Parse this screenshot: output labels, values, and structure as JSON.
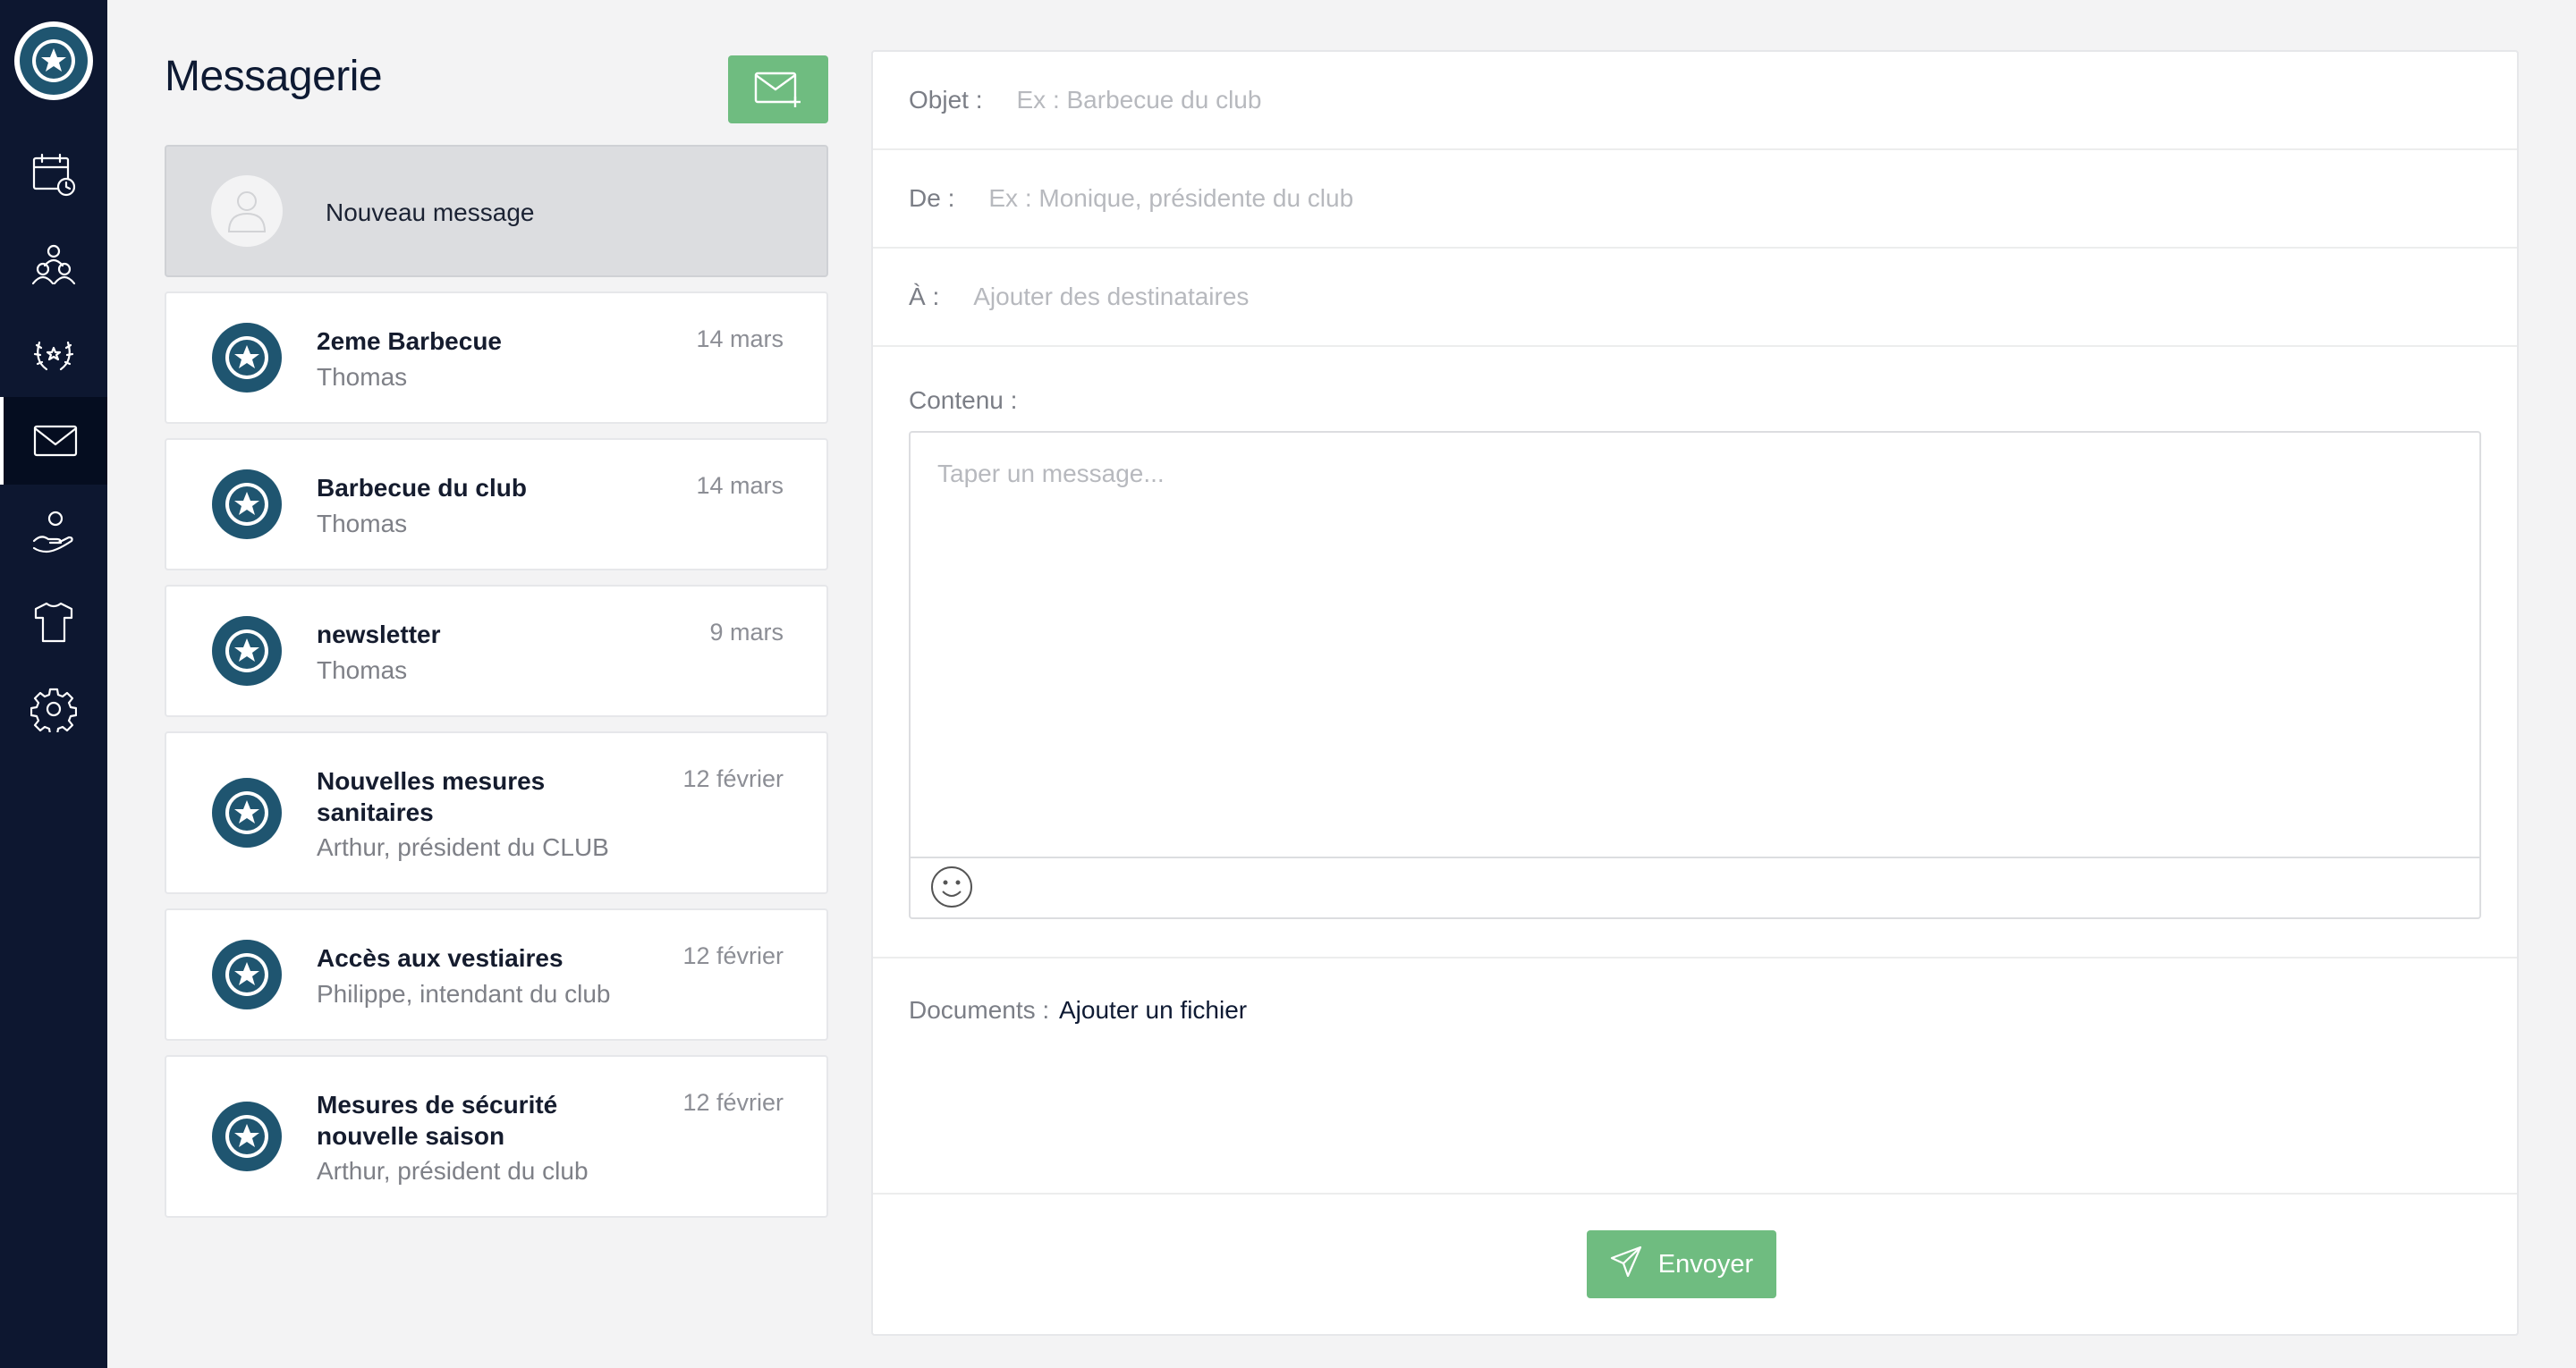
{
  "sidebar": {
    "items": [
      {
        "name": "calendar-icon",
        "active": false
      },
      {
        "name": "users-icon",
        "active": false
      },
      {
        "name": "laurel-icon",
        "active": false
      },
      {
        "name": "mail-icon",
        "active": true
      },
      {
        "name": "hand-user-icon",
        "active": false
      },
      {
        "name": "shirt-icon",
        "active": false
      },
      {
        "name": "gear-icon",
        "active": false
      }
    ]
  },
  "header": {
    "title": "Messagerie",
    "compose_icon": "mail-plus-icon"
  },
  "new_message": {
    "label": "Nouveau message"
  },
  "messages": [
    {
      "title": "2eme Barbecue",
      "sender": "Thomas",
      "date": "14 mars"
    },
    {
      "title": "Barbecue du club",
      "sender": "Thomas",
      "date": "14 mars"
    },
    {
      "title": "newsletter",
      "sender": "Thomas",
      "date": "9 mars"
    },
    {
      "title": "Nouvelles mesures sanitaires",
      "sender": "Arthur, président du CLUB",
      "date": "12 février"
    },
    {
      "title": "Accès aux vestiaires",
      "sender": "Philippe, intendant du club",
      "date": "12 février"
    },
    {
      "title": "Mesures de sécurité nouvelle saison",
      "sender": "Arthur, président du club",
      "date": "12 février"
    }
  ],
  "form": {
    "subject_label": "Objet :",
    "subject_placeholder": "Ex : Barbecue du club",
    "from_label": "De :",
    "from_placeholder": "Ex : Monique, présidente du club",
    "to_label": "À :",
    "to_placeholder": "Ajouter des destinataires",
    "content_label": "Contenu :",
    "content_placeholder": "Taper un message...",
    "documents_label": "Documents :",
    "add_file": "Ajouter un fichier",
    "send_label": "Envoyer"
  },
  "colors": {
    "sidebar": "#0d1730",
    "accent_green": "#6fbc80",
    "club_badge": "#1f5570"
  }
}
